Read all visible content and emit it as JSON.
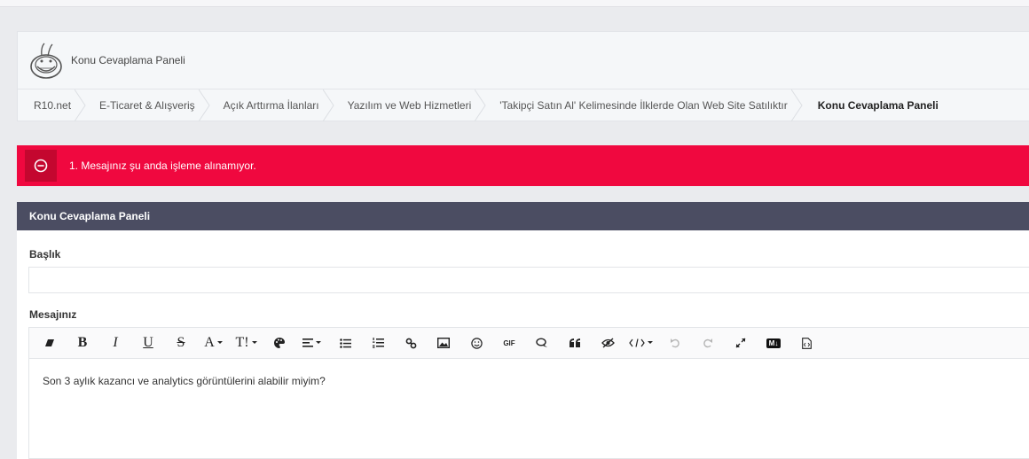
{
  "header": {
    "title": "Konu Cevaplama Paneli"
  },
  "breadcrumb": [
    {
      "label": "R10.net"
    },
    {
      "label": "E-Ticaret & Alışveriş"
    },
    {
      "label": "Açık Arttırma İlanları"
    },
    {
      "label": "Yazılım ve Web Hizmetleri"
    },
    {
      "label": "'Takipçi Satın Al' Kelimesinde İlklerde Olan Web Site Satılıktır"
    },
    {
      "label": "Konu Cevaplama Paneli"
    }
  ],
  "alert": {
    "message": "1. Mesajınız şu anda işleme alınamıyor.",
    "color": "#f0083f"
  },
  "panel": {
    "title": "Konu Cevaplama Paneli",
    "title_label": "Başlık",
    "title_value": "",
    "message_label": "Mesajınız",
    "message_text": "Son 3 aylık kazancı ve analytics görüntülerini alabilir miyim?"
  },
  "toolbar": {
    "bold": "B",
    "italic": "I",
    "underline": "U",
    "strike": "S",
    "font_size": "A",
    "text_transform": "T!",
    "gif": "GIF",
    "markdown": "M↓",
    "icons": [
      "eraser-icon",
      "bold-icon",
      "italic-icon",
      "underline-icon",
      "strikethrough-icon",
      "font-size-icon",
      "text-style-icon",
      "palette-icon",
      "align-icon",
      "bullet-list-icon",
      "numbered-list-icon",
      "link-icon",
      "image-icon",
      "emoji-icon",
      "gif-icon",
      "spoiler-icon",
      "quote-icon",
      "hide-icon",
      "code-icon",
      "undo-icon",
      "redo-icon",
      "fullscreen-icon",
      "markdown-icon",
      "source-icon"
    ]
  }
}
